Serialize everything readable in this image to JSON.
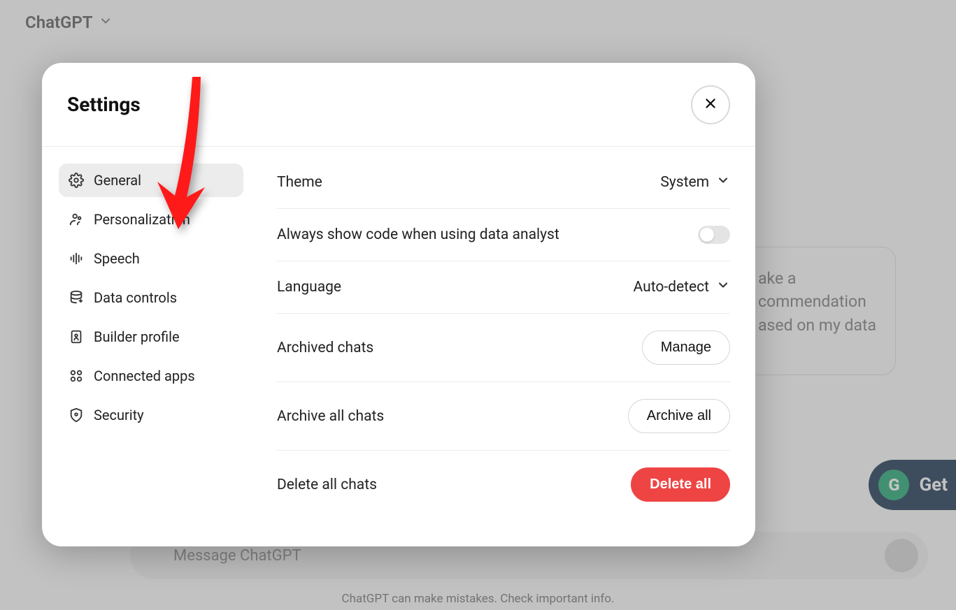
{
  "app": {
    "name": "ChatGPT"
  },
  "background": {
    "suggestion_text": "ake a commendation ased on my data",
    "composer_placeholder": "Message ChatGPT",
    "disclaimer": "ChatGPT can make mistakes. Check important info.",
    "grammarly_label": "Get"
  },
  "modal": {
    "title": "Settings",
    "sidebar": [
      {
        "label": "General"
      },
      {
        "label": "Personalization"
      },
      {
        "label": "Speech"
      },
      {
        "label": "Data controls"
      },
      {
        "label": "Builder profile"
      },
      {
        "label": "Connected apps"
      },
      {
        "label": "Security"
      }
    ],
    "settings": {
      "theme_label": "Theme",
      "theme_value": "System",
      "code_label": "Always show code when using data analyst",
      "language_label": "Language",
      "language_value": "Auto-detect",
      "archived_label": "Archived chats",
      "archived_action": "Manage",
      "archive_all_label": "Archive all chats",
      "archive_all_action": "Archive all",
      "delete_all_label": "Delete all chats",
      "delete_all_action": "Delete all"
    }
  }
}
